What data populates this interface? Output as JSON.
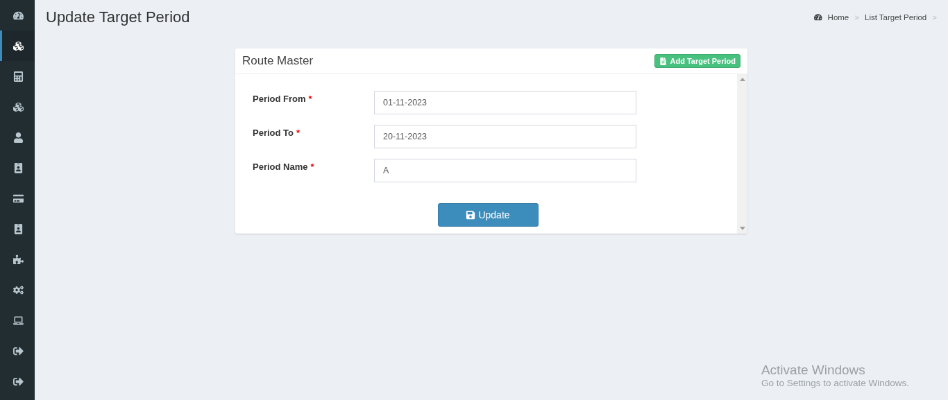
{
  "sidebar": {
    "items": [
      {
        "selected": false
      },
      {
        "selected": true
      },
      {
        "selected": false
      },
      {
        "selected": false
      },
      {
        "selected": false
      },
      {
        "selected": false
      },
      {
        "selected": false
      },
      {
        "selected": false
      },
      {
        "selected": false
      },
      {
        "selected": false
      },
      {
        "selected": false
      },
      {
        "selected": false
      },
      {
        "selected": false
      }
    ]
  },
  "page_title": "Update Target Period",
  "breadcrumb": [
    "Home",
    "List Target Period"
  ],
  "breadcrumb_separator": ">",
  "card": {
    "title": "Route Master",
    "add_button": "Add Target Period",
    "fields": [
      {
        "label": "Period From",
        "required_mark": "*",
        "value": "01-11-2023"
      },
      {
        "label": "Period To",
        "required_mark": "*",
        "value": "20-11-2023"
      },
      {
        "label": "Period Name",
        "required_mark": "*",
        "value": "A"
      }
    ],
    "submit_button": "Update"
  },
  "activation_notice": {
    "title": "Activate Windows",
    "text": "Go to Settings to activate Windows."
  }
}
